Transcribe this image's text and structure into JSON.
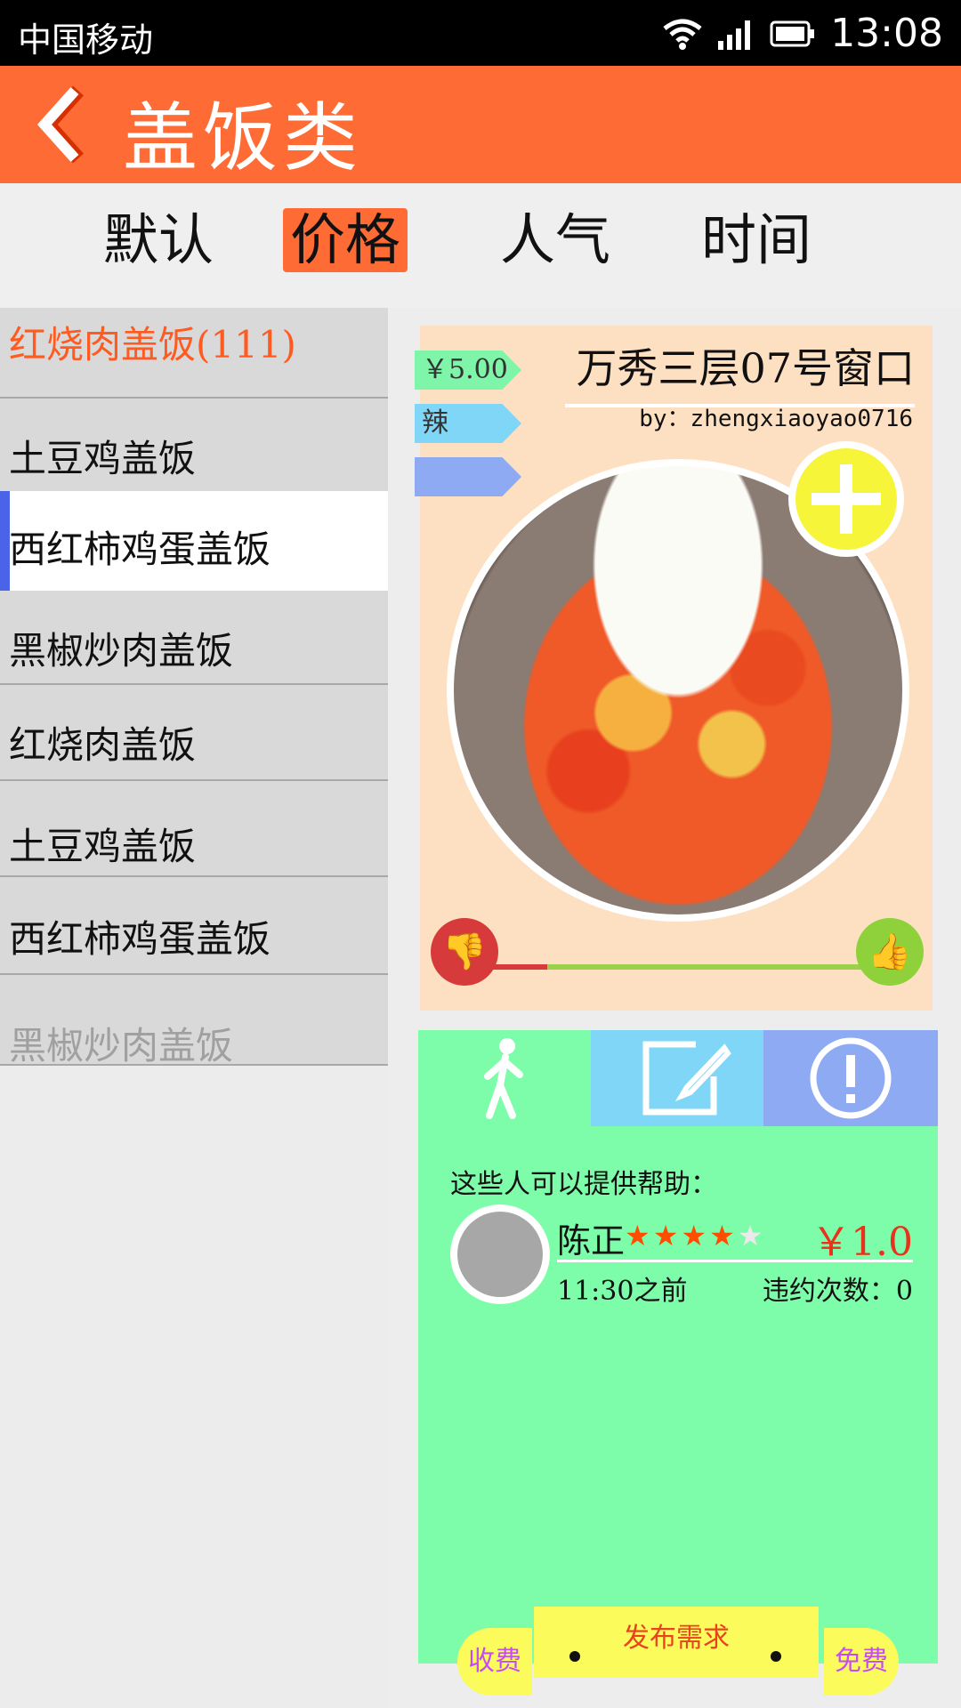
{
  "status": {
    "carrier": "中国移动",
    "time": "13:08"
  },
  "header": {
    "title": "盖饭类"
  },
  "sort_tabs": [
    {
      "label": "默认"
    },
    {
      "label": "价格"
    },
    {
      "label": "人气"
    },
    {
      "label": "时间"
    }
  ],
  "dish_list": [
    {
      "label": "红烧肉盖饭(111)"
    },
    {
      "label": "土豆鸡盖饭"
    },
    {
      "label": "西红柿鸡蛋盖饭"
    },
    {
      "label": "黑椒炒肉盖饭"
    },
    {
      "label": "红烧肉盖饭"
    },
    {
      "label": "土豆鸡盖饭"
    },
    {
      "label": "西红柿鸡蛋盖饭"
    },
    {
      "label": "黑椒炒肉盖饭"
    }
  ],
  "card": {
    "shop": "万秀三层07号窗口",
    "author": "by：zhengxiaoyao0716",
    "price_tag": "￥5.00",
    "spicy_tag": "辣",
    "empty_tag": "",
    "dislike_ratio": 0.18
  },
  "help": {
    "title": "这些人可以提供帮助：",
    "helper": {
      "name": "陈正",
      "rating": 3.5,
      "rating_max": 5,
      "fee": "￥1.0",
      "deadline": "11:30之前",
      "breach": "违约次数：0"
    }
  },
  "bottom": {
    "publish": "发布需求",
    "charge": "收费",
    "free": "免费"
  },
  "colors": {
    "accent": "#ff6b35",
    "panel": "#7dfda9",
    "card": "#fde0c2"
  }
}
